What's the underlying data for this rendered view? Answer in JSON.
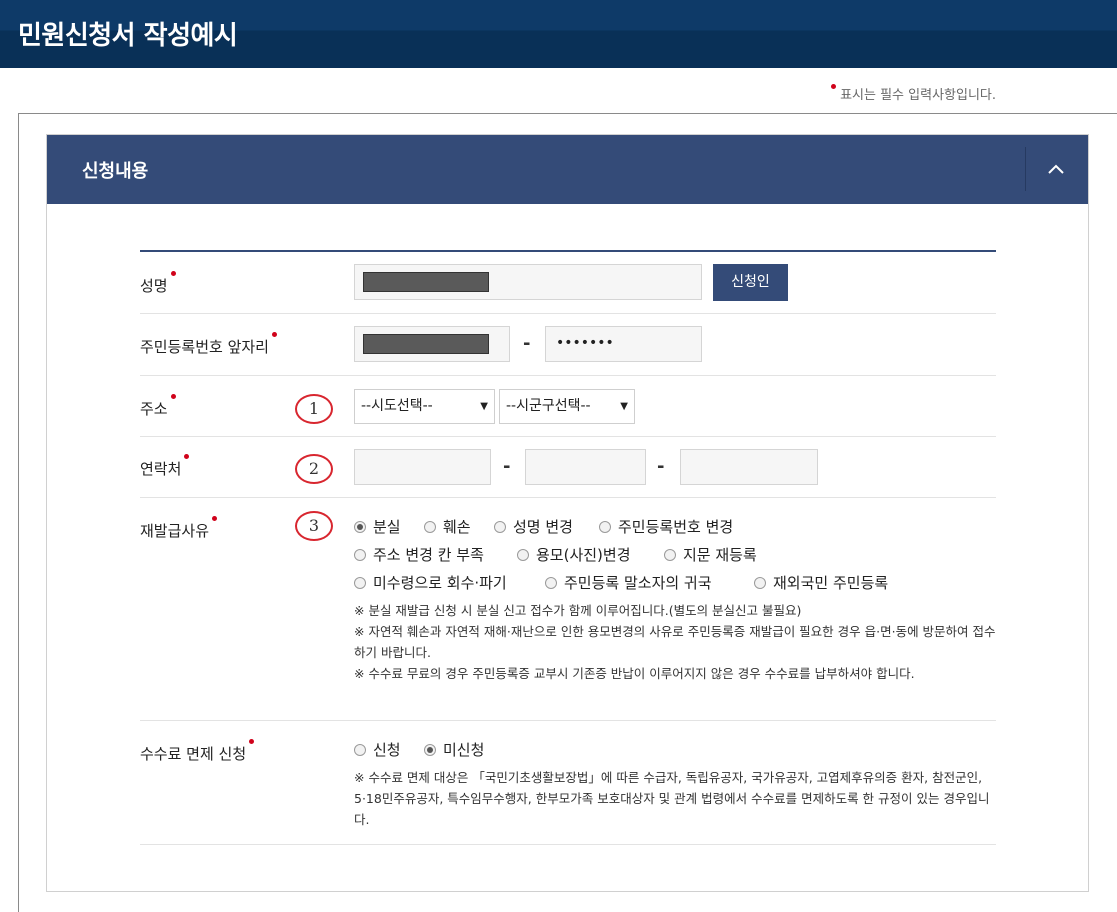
{
  "page": {
    "title": "민원신청서 작성예시"
  },
  "panel": {
    "title": "신청내용"
  },
  "required_note": "표시는 필수 입력사항입니다.",
  "fields": {
    "name": {
      "label": "성명",
      "button": "신청인"
    },
    "rrn_front": {
      "label": "주민등록번호 앞자리",
      "dash": "-",
      "masked": "•••••••"
    },
    "address": {
      "label": "주소",
      "step": "1",
      "sido": "--시도선택--",
      "sigungu": "--시군구선택--"
    },
    "contact": {
      "label": "연락처",
      "step": "2",
      "dash": "-"
    },
    "reason": {
      "label": "재발급사유",
      "step": "3",
      "options": [
        {
          "label": "분실",
          "selected": true
        },
        {
          "label": "훼손",
          "selected": false
        },
        {
          "label": "성명 변경",
          "selected": false
        },
        {
          "label": "주민등록번호 변경",
          "selected": false
        },
        {
          "label": "주소 변경 칸 부족",
          "selected": false
        },
        {
          "label": "용모(사진)변경",
          "selected": false
        },
        {
          "label": "지문 재등록",
          "selected": false
        },
        {
          "label": "미수령으로 회수·파기",
          "selected": false
        },
        {
          "label": "주민등록 말소자의 귀국",
          "selected": false
        },
        {
          "label": "재외국민 주민등록",
          "selected": false
        }
      ],
      "notes": [
        "※ 분실 재발급 신청 시 분실 신고 접수가 함께 이루어집니다.(별도의 분실신고 불필요)",
        "※ 자연적 훼손과 자연적 재해·재난으로 인한 용모변경의 사유로 주민등록증 재발급이 필요한 경우 읍·면·동에 방문하여 접수하기 바랍니다.",
        "※ 수수료 무료의 경우 주민등록증 교부시 기존증 반납이 이루어지지 않은 경우 수수료를 납부하셔야 합니다."
      ]
    },
    "fee": {
      "label": "수수료 면제 신청",
      "options": [
        {
          "label": "신청",
          "selected": false
        },
        {
          "label": "미신청",
          "selected": true
        }
      ],
      "note": "※ 수수료 면제 대상은 「국민기초생활보장법」에 따른 수급자, 독립유공자, 국가유공자, 고엽제후유의증 환자, 참전군인, 5·18민주유공자, 특수임무수행자, 한부모가족 보호대상자 및 관계 법령에서 수수료를 면제하도록 한 규정이 있는 경우입니다."
    }
  },
  "colors": {
    "topbar": "#0e3a68",
    "panel_header": "#344b78",
    "required_dot": "#d0021b",
    "step_circle": "#d8262f"
  }
}
